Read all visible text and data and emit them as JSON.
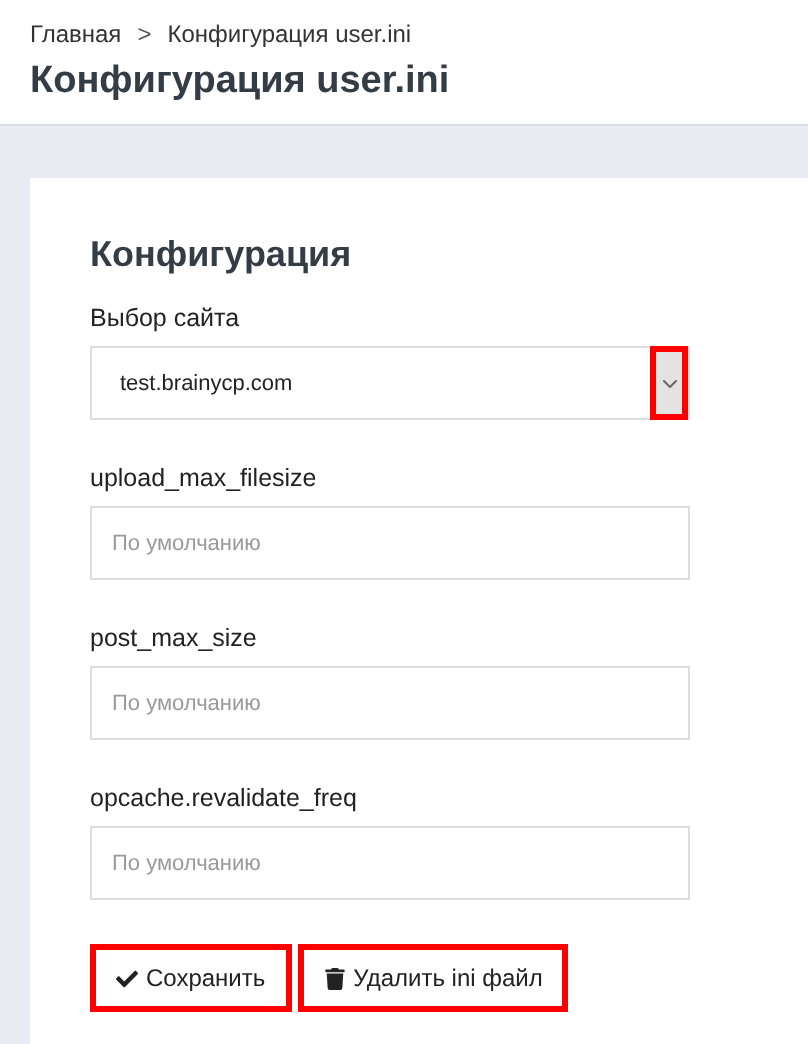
{
  "breadcrumbs": [
    "Главная",
    "Конфигурация user.ini"
  ],
  "breadcrumb_separator": ">",
  "page_title": "Конфигурация user.ini",
  "card_title": "Конфигурация",
  "site_select": {
    "label": "Выбор сайта",
    "value": "test.brainycp.com"
  },
  "fields": [
    {
      "label": "upload_max_filesize",
      "placeholder": "По умолчанию"
    },
    {
      "label": "post_max_size",
      "placeholder": "По умолчанию"
    },
    {
      "label": "opcache.revalidate_freq",
      "placeholder": "По умолчанию"
    }
  ],
  "buttons": [
    {
      "kind": "save",
      "label": "Сохранить"
    },
    {
      "kind": "delete",
      "label": "Удалить ini файл"
    }
  ]
}
